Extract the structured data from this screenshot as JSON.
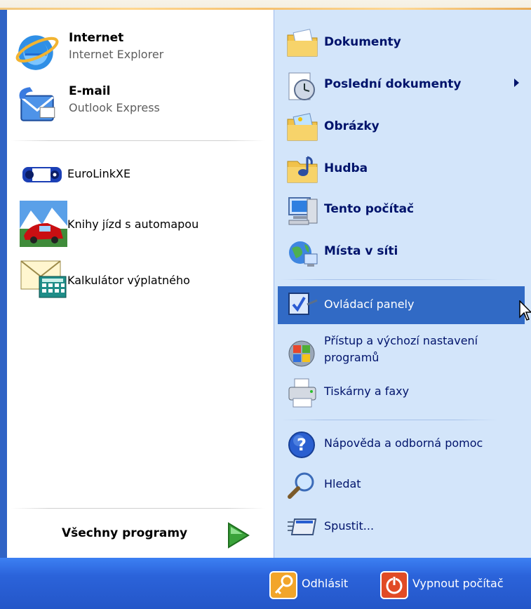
{
  "pinned": [
    {
      "title": "Internet",
      "subtitle": "Internet Explorer",
      "icon": "internet-explorer-icon"
    },
    {
      "title": "E-mail",
      "subtitle": "Outlook Express",
      "icon": "outlook-express-icon"
    }
  ],
  "recent": [
    {
      "label": "EuroLinkXE",
      "icon": "eurolinkxe-icon"
    },
    {
      "label": "Knihy jízd s automapou",
      "icon": "car-logbook-icon"
    },
    {
      "label": "Kalkulátor výplatného",
      "icon": "calculator-envelope-icon"
    }
  ],
  "all_programs": {
    "label": "Všechny programy"
  },
  "places": [
    {
      "label": "Dokumenty",
      "icon": "documents-folder-icon"
    },
    {
      "label": "Poslední dokumenty",
      "icon": "recent-documents-icon",
      "submenu": true
    },
    {
      "label": "Obrázky",
      "icon": "pictures-folder-icon"
    },
    {
      "label": "Hudba",
      "icon": "music-folder-icon"
    },
    {
      "label": "Tento počítač",
      "icon": "my-computer-icon"
    },
    {
      "label": "Místa v síti",
      "icon": "network-places-icon"
    }
  ],
  "settings": [
    {
      "label": "Ovládací panely",
      "icon": "control-panel-icon",
      "selected": true
    },
    {
      "label": "Přístup a výchozí nastavení",
      "label2": "programů",
      "icon": "program-access-icon"
    },
    {
      "label": "Tiskárny a faxy",
      "icon": "printer-icon"
    }
  ],
  "tools": [
    {
      "label": "Nápověda a odborná pomoc",
      "icon": "help-icon"
    },
    {
      "label": "Hledat",
      "icon": "search-icon"
    },
    {
      "label": "Spustit...",
      "icon": "run-icon"
    }
  ],
  "bottom": {
    "logoff": "Odhlásit",
    "shutdown": "Vypnout počítač"
  },
  "colors": {
    "selection": "#316ac5",
    "right_pane": "#d3e5fa",
    "bottom_bar": "#2b63da",
    "link_text": "#00136b"
  }
}
